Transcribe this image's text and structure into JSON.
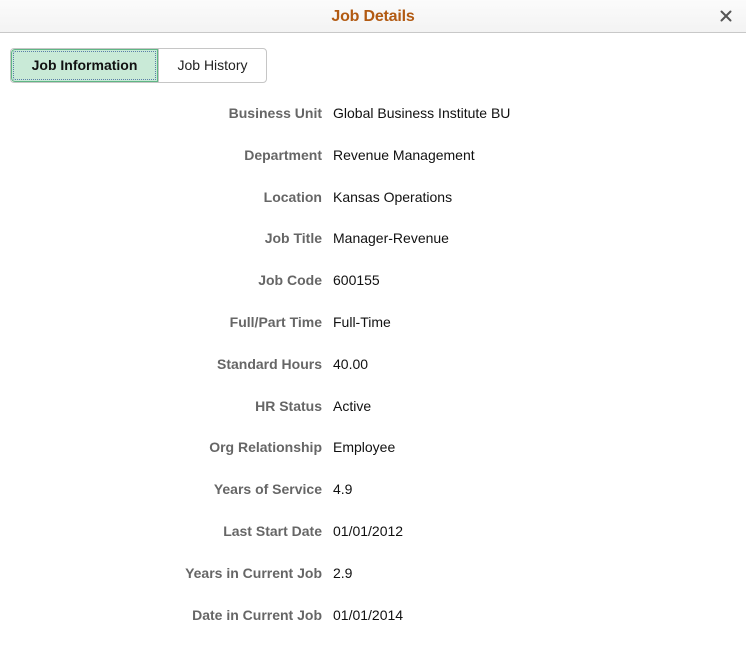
{
  "dialog": {
    "title": "Job Details",
    "close_icon": "close-icon"
  },
  "tabs": [
    {
      "label": "Job Information",
      "active": true
    },
    {
      "label": "Job History",
      "active": false
    }
  ],
  "fields": [
    {
      "label": "Business Unit",
      "value": "Global Business Institute BU"
    },
    {
      "label": "Department",
      "value": "Revenue Management"
    },
    {
      "label": "Location",
      "value": "Kansas Operations"
    },
    {
      "label": "Job Title",
      "value": "Manager-Revenue"
    },
    {
      "label": "Job Code",
      "value": "600155"
    },
    {
      "label": "Full/Part Time",
      "value": "Full-Time"
    },
    {
      "label": "Standard Hours",
      "value": "40.00"
    },
    {
      "label": "HR Status",
      "value": "Active"
    },
    {
      "label": "Org Relationship",
      "value": "Employee"
    },
    {
      "label": "Years of Service",
      "value": "4.9"
    },
    {
      "label": "Last Start Date",
      "value": "01/01/2012"
    },
    {
      "label": "Years in Current Job",
      "value": "2.9"
    },
    {
      "label": "Date in Current Job",
      "value": "01/01/2014"
    }
  ],
  "colors": {
    "title": "#b25a12",
    "active_tab_bg": "#c9ead7",
    "active_tab_border": "#5fb685",
    "label": "#666666"
  }
}
